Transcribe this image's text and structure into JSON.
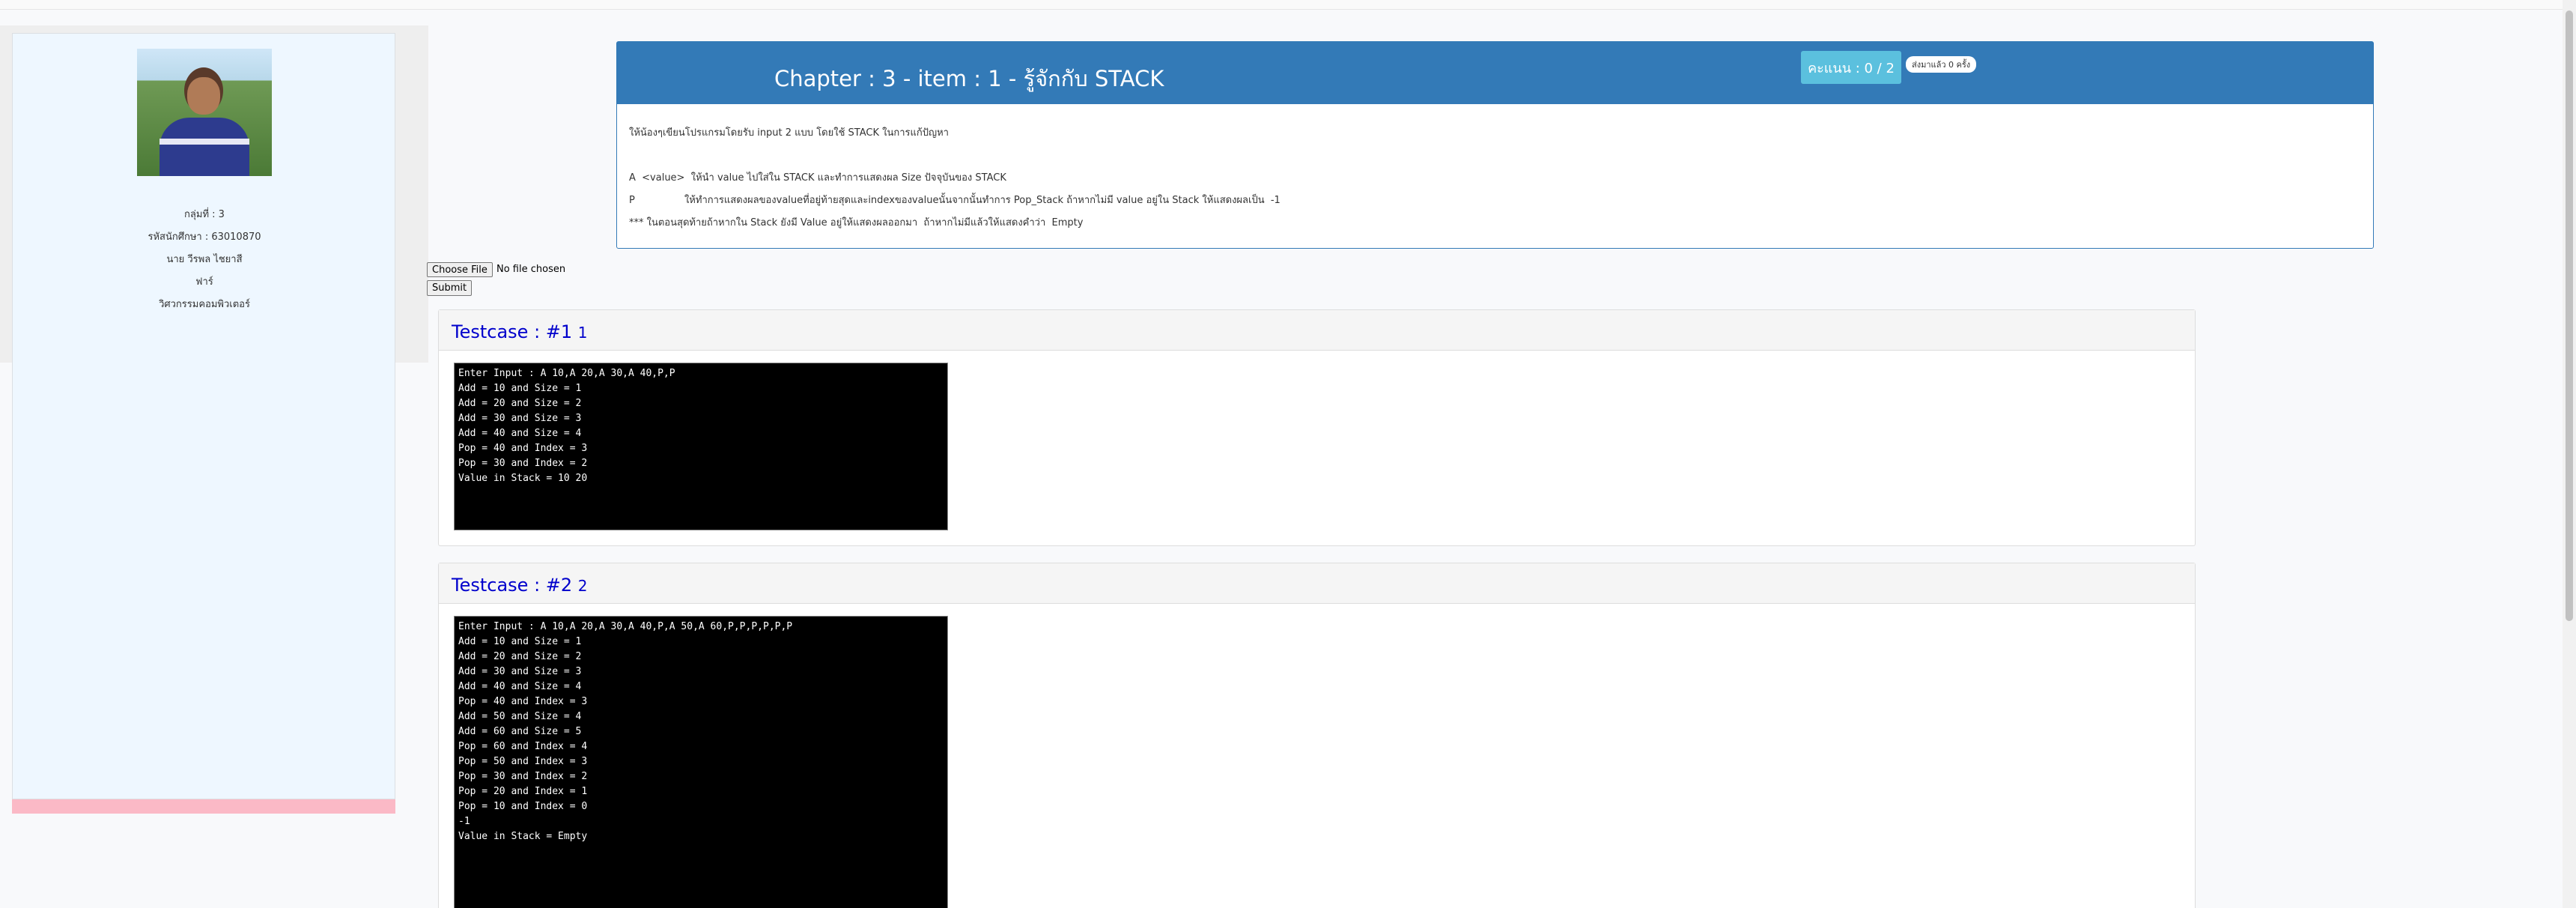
{
  "sidebar": {
    "group": "กลุ่มที่ : 3",
    "student_id": "รหัสนักศึกษา : 63010870",
    "name": "นาย วีรพล ไชยาสี",
    "nickname": "ฟาร์",
    "faculty": "วิศวกรรมคอมพิวเตอร์"
  },
  "task": {
    "title": "Chapter : 3 - item : 1 - รู้จักกับ STACK",
    "score": "คะแนน : 0 / 2",
    "attempts": "ส่งมาแล้ว 0 ครั้ง",
    "description": [
      "ให้น้องๆเขียนโปรแกรมโดยรับ input 2 แบบ โดยใช้ STACK ในการแก้ปัญหา",
      "A  <value>  ให้นำ value ไปใส่ใน STACK และทำการแสดงผล Size ปัจจุบันของ STACK",
      "P                ให้ทำการแสดงผลของvalueที่อยู่ท้ายสุดและindexของvalueนั้นจากนั้นทำการ Pop_Stack ถ้าหากไม่มี value อยู่ใน Stack ให้แสดงผลเป็น  -1",
      "*** ในตอนสุดท้ายถ้าหากใน Stack ยังมี Value อยู่ให้แสดงผลออกมา  ถ้าหากไม่มีแล้วให้แสดงคำว่า  Empty"
    ]
  },
  "upload": {
    "choose_label": "Choose File",
    "no_file": "No file chosen",
    "submit_label": "Submit"
  },
  "testcases": [
    {
      "label": "Testcase : #1",
      "num": "1",
      "output": "Enter Input : A 10,A 20,A 30,A 40,P,P\nAdd = 10 and Size = 1\nAdd = 20 and Size = 2\nAdd = 30 and Size = 3\nAdd = 40 and Size = 4\nPop = 40 and Index = 3\nPop = 30 and Index = 2\nValue in Stack = 10 20"
    },
    {
      "label": "Testcase : #2",
      "num": "2",
      "output": "Enter Input : A 10,A 20,A 30,A 40,P,A 50,A 60,P,P,P,P,P,P\nAdd = 10 and Size = 1\nAdd = 20 and Size = 2\nAdd = 30 and Size = 3\nAdd = 40 and Size = 4\nPop = 40 and Index = 3\nAdd = 50 and Size = 4\nAdd = 60 and Size = 5\nPop = 60 and Index = 4\nPop = 50 and Index = 3\nPop = 30 and Index = 2\nPop = 20 and Index = 1\nPop = 10 and Index = 0\n-1\nValue in Stack = Empty"
    }
  ]
}
